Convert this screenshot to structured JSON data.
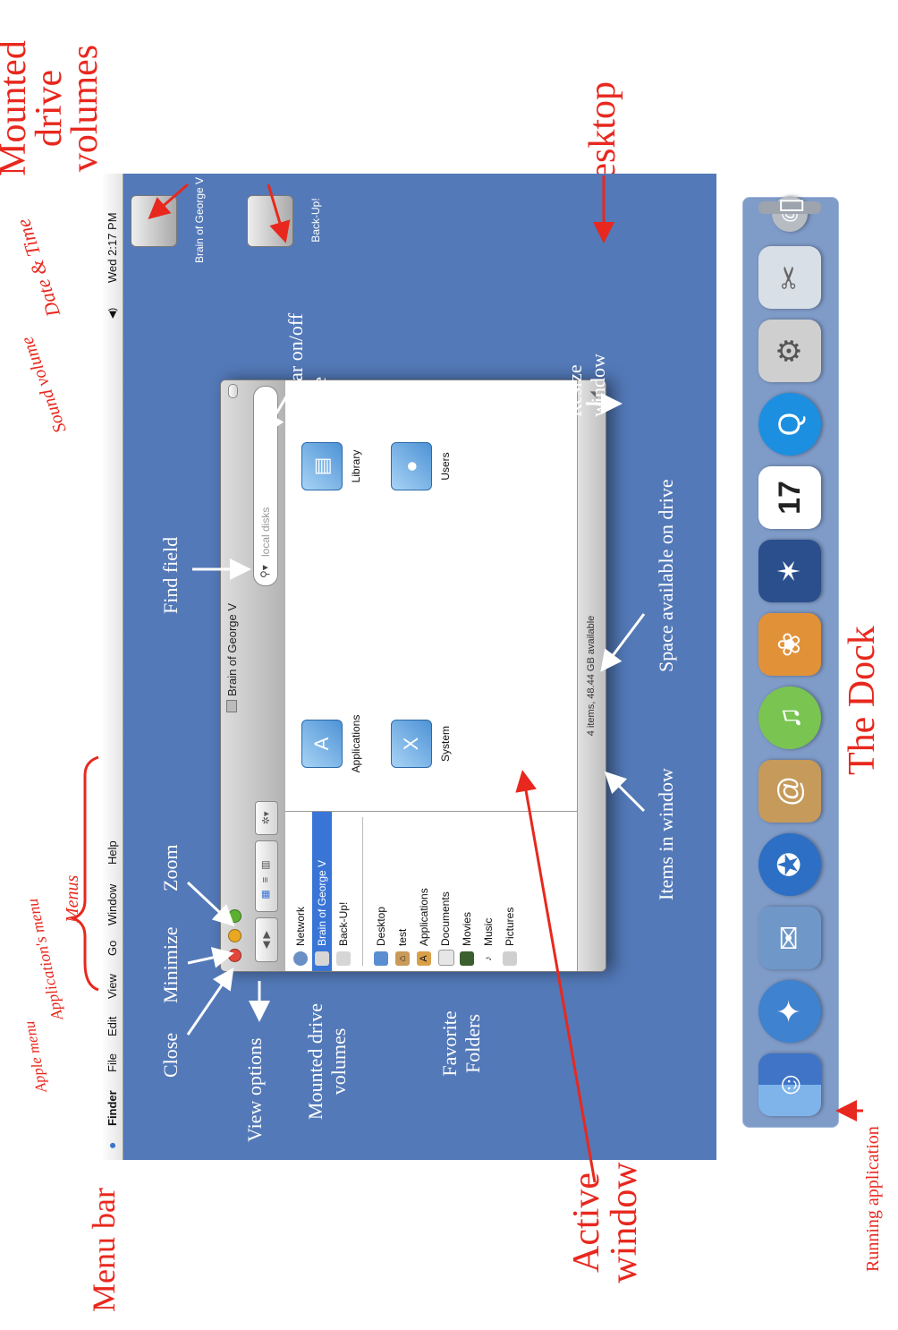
{
  "menubar": {
    "apple_glyph": "",
    "items": [
      "Finder",
      "File",
      "Edit",
      "View",
      "Go",
      "Window",
      "Help"
    ],
    "status": {
      "volume_glyph": "◀)",
      "clock": "Wed 2:17 PM"
    }
  },
  "desktop_icons": [
    {
      "label": "Brain of George V",
      "icon": "hard-drive-icon"
    },
    {
      "label": "Back-Up!",
      "icon": "hard-drive-icon"
    }
  ],
  "window": {
    "title": "Brain of George V",
    "search_placeholder": "local disks",
    "sidebar_volumes": [
      {
        "label": "Network",
        "icon": "globe-icon"
      },
      {
        "label": "Brain of George V",
        "icon": "hard-drive-icon",
        "selected": true
      },
      {
        "label": "Back-Up!",
        "icon": "hard-drive-icon"
      }
    ],
    "sidebar_folders": [
      {
        "label": "Desktop",
        "icon": "desktop-folder-icon"
      },
      {
        "label": "test",
        "icon": "home-icon"
      },
      {
        "label": "Applications",
        "icon": "applications-icon"
      },
      {
        "label": "Documents",
        "icon": "documents-icon"
      },
      {
        "label": "Movies",
        "icon": "movies-icon"
      },
      {
        "label": "Music",
        "icon": "music-icon"
      },
      {
        "label": "Pictures",
        "icon": "pictures-icon"
      }
    ],
    "items": [
      {
        "label": "Applications",
        "icon": "applications-folder-icon"
      },
      {
        "label": "Library",
        "icon": "library-folder-icon"
      },
      {
        "label": "System",
        "icon": "system-folder-icon"
      },
      {
        "label": "Users",
        "icon": "users-folder-icon"
      }
    ],
    "status_text": "4 items, 48.44 GB available"
  },
  "dock": {
    "items": [
      "finder-icon",
      "safari-icon",
      "mail-icon",
      "ichat-icon",
      "address-book-icon",
      "itunes-icon",
      "iphoto-icon",
      "imovie-icon",
      "ical-icon",
      "quicktime-icon",
      "system-preferences-icon",
      "preview-icon",
      "mail-server-icon",
      "trash-icon"
    ],
    "ical_date": "17"
  },
  "annotations": {
    "mounted_drive_volumes_top": "Mounted drive volumes",
    "desktop": "Desktop",
    "date_time": "Date & Time",
    "sound_volume": "Sound volume",
    "sidebar_toggle": "Sidebar on/off toggle",
    "resize_window": "Resize window",
    "find_field": "Find field",
    "space_available": "Space available on drive",
    "the_dock": "The Dock",
    "menus": "Menus",
    "apple_menu": "Apple menu",
    "application_menu": "Application's menu",
    "close": "Close",
    "minimize": "Minimize",
    "zoom": "Zoom",
    "view_options": "View options",
    "mounted_drive_volumes": "Mounted drive volumes",
    "favorite_folders": "Favorite Folders",
    "items_in_window": "Items in window",
    "active_window": "Active window",
    "menu_bar": "Menu bar",
    "running_application": "Running application"
  },
  "colors": {
    "desktop": "#5379b8",
    "annotation_red": "#e8281e",
    "selection": "#3875d7"
  }
}
